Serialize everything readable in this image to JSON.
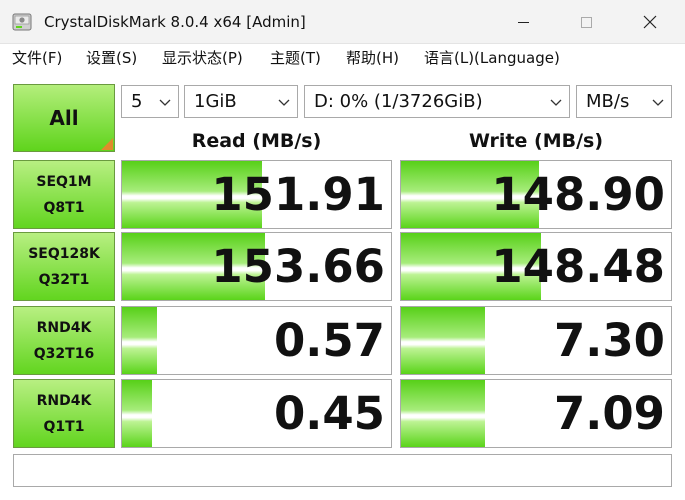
{
  "window": {
    "title": "CrystalDiskMark 8.0.4 x64 [Admin]",
    "icon": "disk-app-icon"
  },
  "menu": {
    "items": [
      {
        "label": "文件(F)"
      },
      {
        "label": "设置(S)"
      },
      {
        "label": "显示状态(P)"
      },
      {
        "label": "主题(T)"
      },
      {
        "label": "帮助(H)"
      },
      {
        "label": "语言(L)(Language)"
      }
    ]
  },
  "controls": {
    "all_label": "All",
    "test_count": "5",
    "test_size": "1GiB",
    "drive": "D: 0% (1/3726GiB)",
    "unit": "MB/s"
  },
  "headers": {
    "read": "Read (MB/s)",
    "write": "Write (MB/s)"
  },
  "results": [
    {
      "line1": "SEQ1M",
      "line2": "Q8T1",
      "read": "151.91",
      "write": "148.90",
      "read_fill": 0.52,
      "write_fill": 0.51
    },
    {
      "line1": "SEQ128K",
      "line2": "Q32T1",
      "read": "153.66",
      "write": "148.48",
      "read_fill": 0.53,
      "write_fill": 0.52
    },
    {
      "line1": "RND4K",
      "line2": "Q32T16",
      "read": "0.57",
      "write": "7.30",
      "read_fill": 0.13,
      "write_fill": 0.31
    },
    {
      "line1": "RND4K",
      "line2": "Q1T1",
      "read": "0.45",
      "write": "7.09",
      "read_fill": 0.11,
      "write_fill": 0.31
    }
  ],
  "comment": "",
  "colors": {
    "accent_green": "#5fd41c",
    "corner_orange": "#e08a2c"
  }
}
